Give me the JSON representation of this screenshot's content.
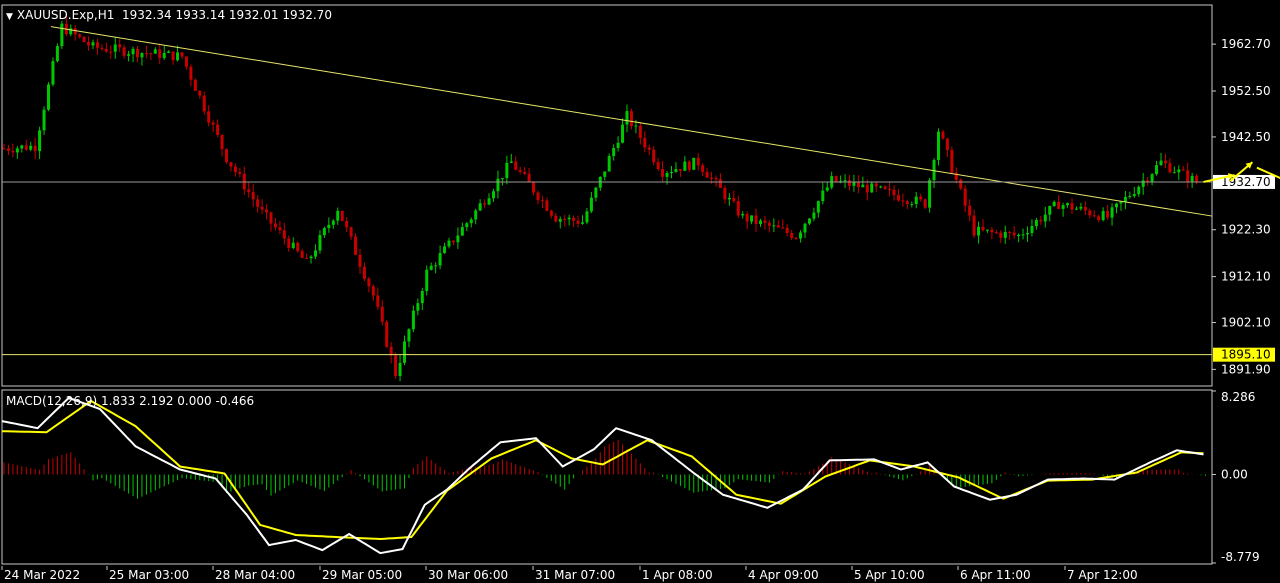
{
  "header": {
    "symbol": "XAUUSD.Exp,H1",
    "ohlc": "1932.34 1933.14 1932.01 1932.70"
  },
  "macd": {
    "label": "MACD(12,26,9) 1.833 2.192 0.000 -0.466",
    "axis_max": "8.286",
    "axis_mid": "0.00",
    "axis_min": "-8.779"
  },
  "colors": {
    "bull": "#00c800",
    "bear": "#c80000",
    "trendline": "#e8e86a",
    "level": "#e8e86a",
    "price_label_bg": "#ffffff",
    "level_label_bg": "#ffff00",
    "macd_line": "#ffffff",
    "signal_line": "#ffff00",
    "arrow": "#ffff00"
  },
  "chart_data": [
    {
      "type": "candlestick",
      "title": "XAUUSD.Exp,H1",
      "ylim": [
        1888.5,
        1971.0
      ],
      "y_ticks": [
        "1962.70",
        "1952.50",
        "1942.50",
        "1922.30",
        "1912.10",
        "1902.10",
        "1891.90"
      ],
      "current_price": "1932.70",
      "support_level": "1895.10",
      "x_labels": [
        "24 Mar 2022",
        "25 Mar 03:00",
        "28 Mar 04:00",
        "29 Mar 05:00",
        "30 Mar 06:00",
        "31 Mar 07:00",
        "1 Apr 08:00",
        "4 Apr 09:00",
        "5 Apr 10:00",
        "6 Apr 11:00",
        "7 Apr 12:00"
      ],
      "trendline": {
        "start": {
          "bar": 11,
          "price": 1966.5
        },
        "end": {
          "bar": 242,
          "price": 1930.0
        }
      },
      "key_points": [
        {
          "bar": 0,
          "price": 1940.0
        },
        {
          "bar": 7,
          "price": 1940.5
        },
        {
          "bar": 13,
          "price": 1966.5
        },
        {
          "bar": 20,
          "price": 1962.0
        },
        {
          "bar": 40,
          "price": 1960.0
        },
        {
          "bar": 50,
          "price": 1938.0
        },
        {
          "bar": 58,
          "price": 1926.0
        },
        {
          "bar": 68,
          "price": 1915.0
        },
        {
          "bar": 75,
          "price": 1927.0
        },
        {
          "bar": 83,
          "price": 1908.0
        },
        {
          "bar": 88,
          "price": 1891.0
        },
        {
          "bar": 95,
          "price": 1913.0
        },
        {
          "bar": 105,
          "price": 1925.0
        },
        {
          "bar": 114,
          "price": 1937.0
        },
        {
          "bar": 124,
          "price": 1925.0
        },
        {
          "bar": 130,
          "price": 1924.0
        },
        {
          "bar": 140,
          "price": 1947.0
        },
        {
          "bar": 148,
          "price": 1935.0
        },
        {
          "bar": 156,
          "price": 1937.0
        },
        {
          "bar": 166,
          "price": 1925.0
        },
        {
          "bar": 178,
          "price": 1921.0
        },
        {
          "bar": 186,
          "price": 1933.0
        },
        {
          "bar": 196,
          "price": 1931.0
        },
        {
          "bar": 207,
          "price": 1928.0
        },
        {
          "bar": 210,
          "price": 1944.0
        },
        {
          "bar": 218,
          "price": 1922.0
        },
        {
          "bar": 228,
          "price": 1921.0
        },
        {
          "bar": 237,
          "price": 1928.0
        },
        {
          "bar": 248,
          "price": 1925.0
        },
        {
          "bar": 260,
          "price": 1937.0
        },
        {
          "bar": 268,
          "price": 1932.7
        }
      ],
      "forecast_arrows": [
        {
          "from": {
            "bar": 270,
            "price": 1932.7
          },
          "to": {
            "bar": 277,
            "price": 1934.2
          }
        },
        {
          "from": {
            "bar": 276,
            "price": 1932.9
          },
          "to": {
            "bar": 281,
            "price": 1937.0
          }
        },
        {
          "from": {
            "bar": 282,
            "price": 1935.8
          },
          "to": {
            "bar": 292,
            "price": 1931.5
          }
        },
        {
          "from": {
            "bar": 291,
            "price": 1932.5
          },
          "to": {
            "bar": 296,
            "price": 1941.0
          }
        }
      ]
    },
    {
      "type": "line",
      "title": "MACD(12,26,9) 1.833 2.192 0.000 -0.466",
      "ylim": [
        -8.779,
        8.286
      ],
      "series": [
        {
          "role": "macd",
          "points": [
            [
              0,
              5.3
            ],
            [
              8,
              4.6
            ],
            [
              15,
              7.6
            ],
            [
              22,
              6.5
            ],
            [
              30,
              2.8
            ],
            [
              40,
              0.5
            ],
            [
              48,
              -0.4
            ],
            [
              55,
              -4.0
            ],
            [
              60,
              -7.0
            ],
            [
              66,
              -6.5
            ],
            [
              72,
              -7.5
            ],
            [
              78,
              -5.9
            ],
            [
              85,
              -7.8
            ],
            [
              90,
              -7.4
            ],
            [
              95,
              -3.0
            ],
            [
              100,
              -1.5
            ],
            [
              105,
              0.6
            ],
            [
              112,
              3.2
            ],
            [
              120,
              3.6
            ],
            [
              126,
              0.8
            ],
            [
              133,
              2.5
            ],
            [
              138,
              4.6
            ],
            [
              146,
              3.4
            ],
            [
              155,
              0.3
            ],
            [
              162,
              -2.0
            ],
            [
              172,
              -3.3
            ],
            [
              180,
              -1.5
            ],
            [
              186,
              1.4
            ],
            [
              196,
              1.5
            ],
            [
              202,
              0.5
            ],
            [
              208,
              1.2
            ],
            [
              214,
              -1.2
            ],
            [
              222,
              -2.5
            ],
            [
              228,
              -2.0
            ],
            [
              235,
              -0.5
            ],
            [
              243,
              -0.4
            ],
            [
              250,
              -0.5
            ],
            [
              258,
              1.2
            ],
            [
              264,
              2.4
            ],
            [
              270,
              2.0
            ]
          ]
        },
        {
          "role": "signal",
          "points": [
            [
              0,
              4.3
            ],
            [
              10,
              4.2
            ],
            [
              20,
              7.3
            ],
            [
              30,
              4.8
            ],
            [
              40,
              0.8
            ],
            [
              50,
              0.1
            ],
            [
              58,
              -5.0
            ],
            [
              66,
              -6.0
            ],
            [
              75,
              -6.2
            ],
            [
              85,
              -6.4
            ],
            [
              92,
              -6.2
            ],
            [
              100,
              -1.6
            ],
            [
              110,
              1.6
            ],
            [
              120,
              3.4
            ],
            [
              128,
              1.6
            ],
            [
              135,
              1.0
            ],
            [
              145,
              3.4
            ],
            [
              155,
              1.8
            ],
            [
              165,
              -2.0
            ],
            [
              175,
              -2.9
            ],
            [
              185,
              -0.2
            ],
            [
              195,
              1.4
            ],
            [
              205,
              0.8
            ],
            [
              215,
              -0.3
            ],
            [
              225,
              -2.4
            ],
            [
              235,
              -0.6
            ],
            [
              245,
              -0.5
            ],
            [
              255,
              0.2
            ],
            [
              265,
              2.2
            ],
            [
              270,
              2.1
            ]
          ]
        }
      ]
    }
  ]
}
